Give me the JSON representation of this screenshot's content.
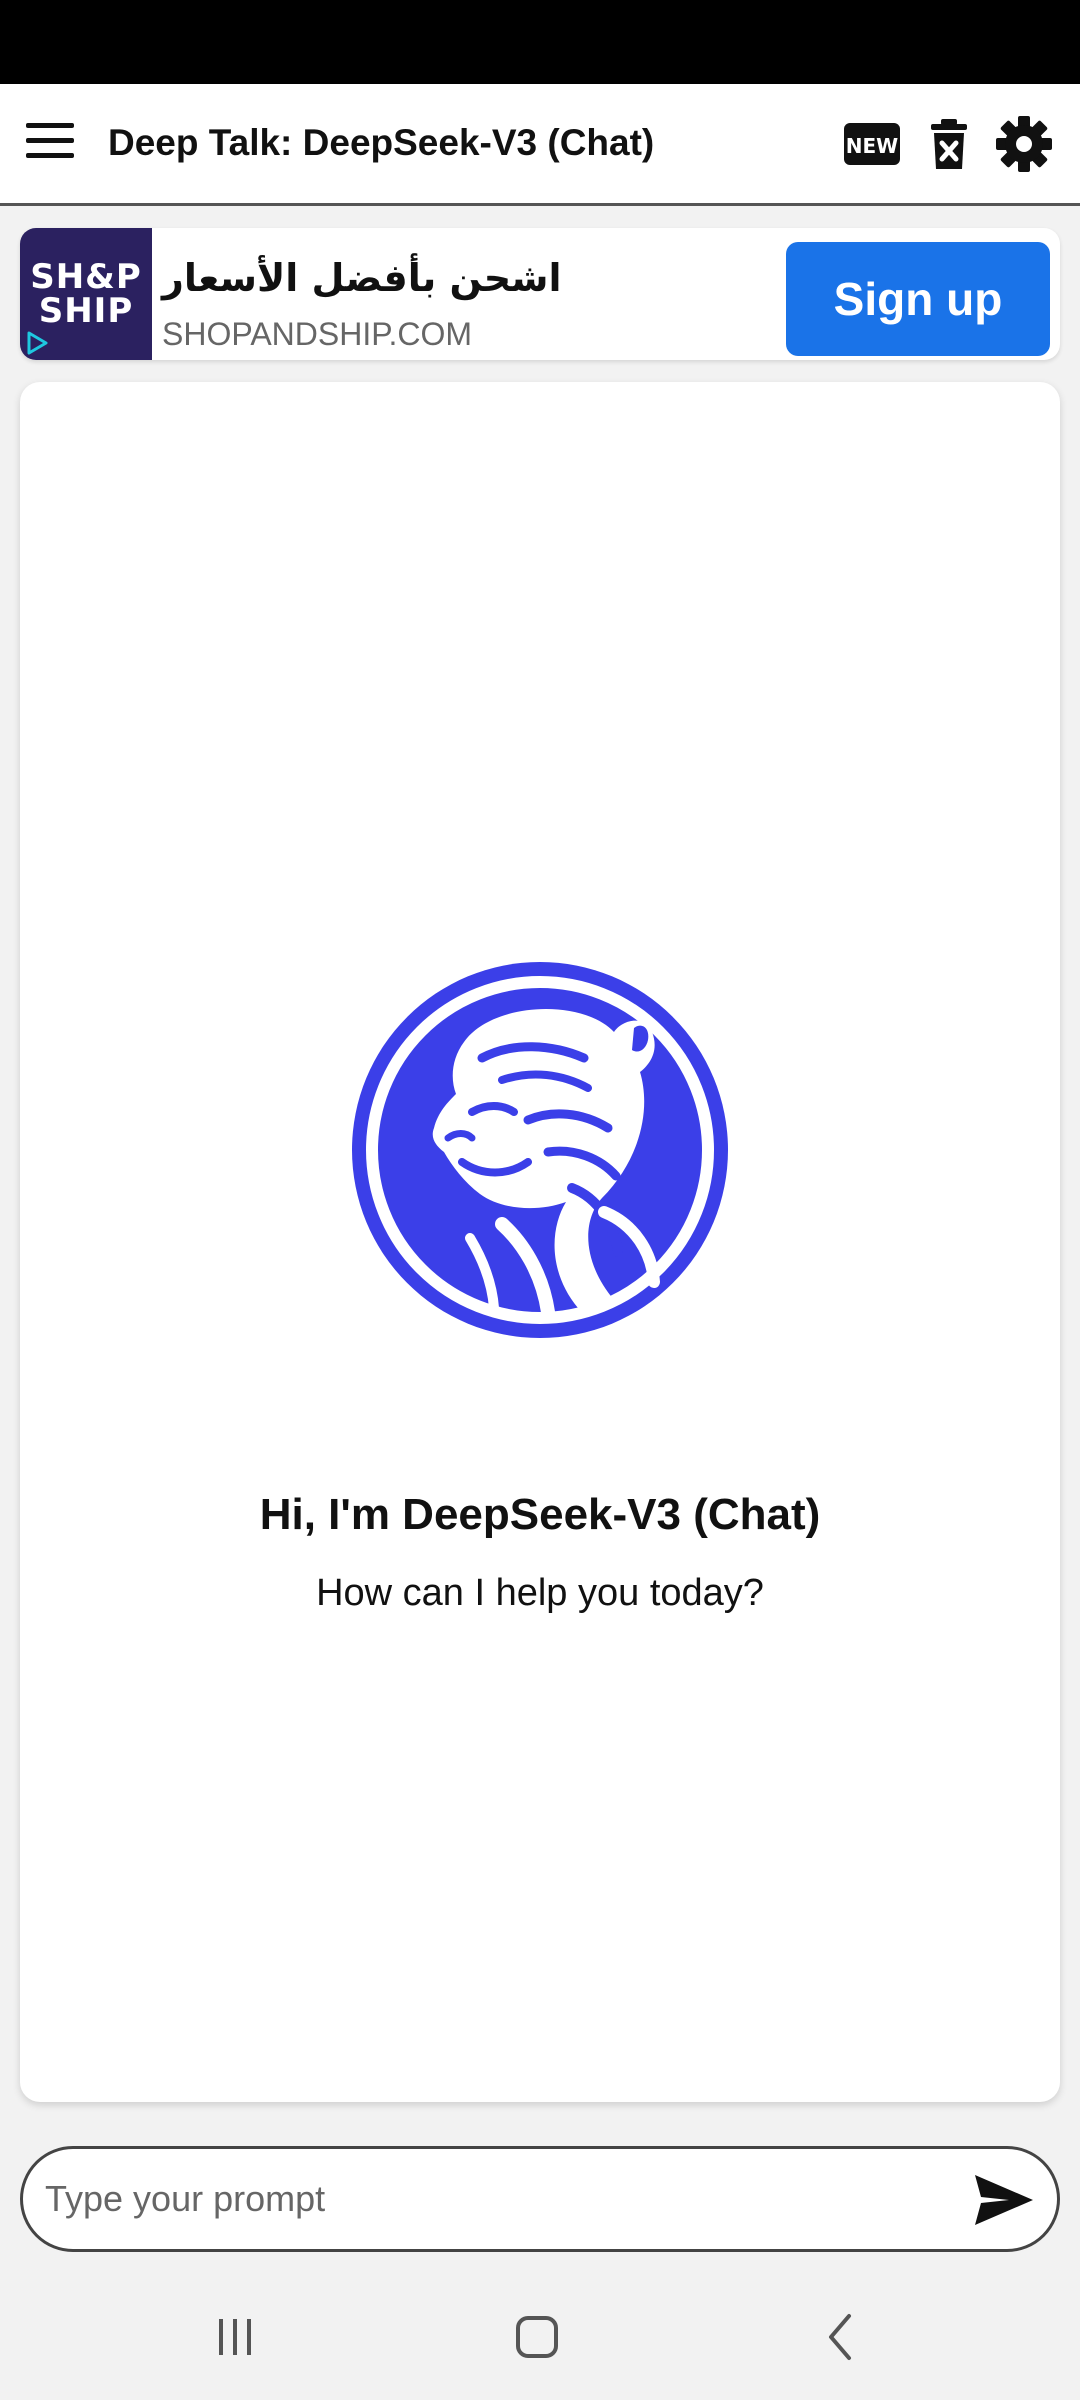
{
  "app_bar": {
    "title": "Deep Talk: DeepSeek-V3 (Chat)",
    "new_icon_text": "NEW",
    "icons": [
      "menu-icon",
      "new-chat-icon",
      "trash-icon",
      "gear-icon"
    ]
  },
  "ad": {
    "logo_line1": "SH&P",
    "logo_line2": "SHIP",
    "headline": "اشحن بأفضل الأسعار",
    "domain": "SHOPANDSHIP.COM",
    "cta": "Sign up",
    "cta_color": "#1a73e8"
  },
  "chat": {
    "greeting": "Hi, I'm DeepSeek-V3 (Chat)",
    "subgreeting": "How can I help you today?",
    "logo_color": "#3b3fe8"
  },
  "prompt": {
    "placeholder": "Type your prompt",
    "value": ""
  },
  "nav": {
    "icons": [
      "recents-icon",
      "home-icon",
      "back-icon"
    ]
  }
}
